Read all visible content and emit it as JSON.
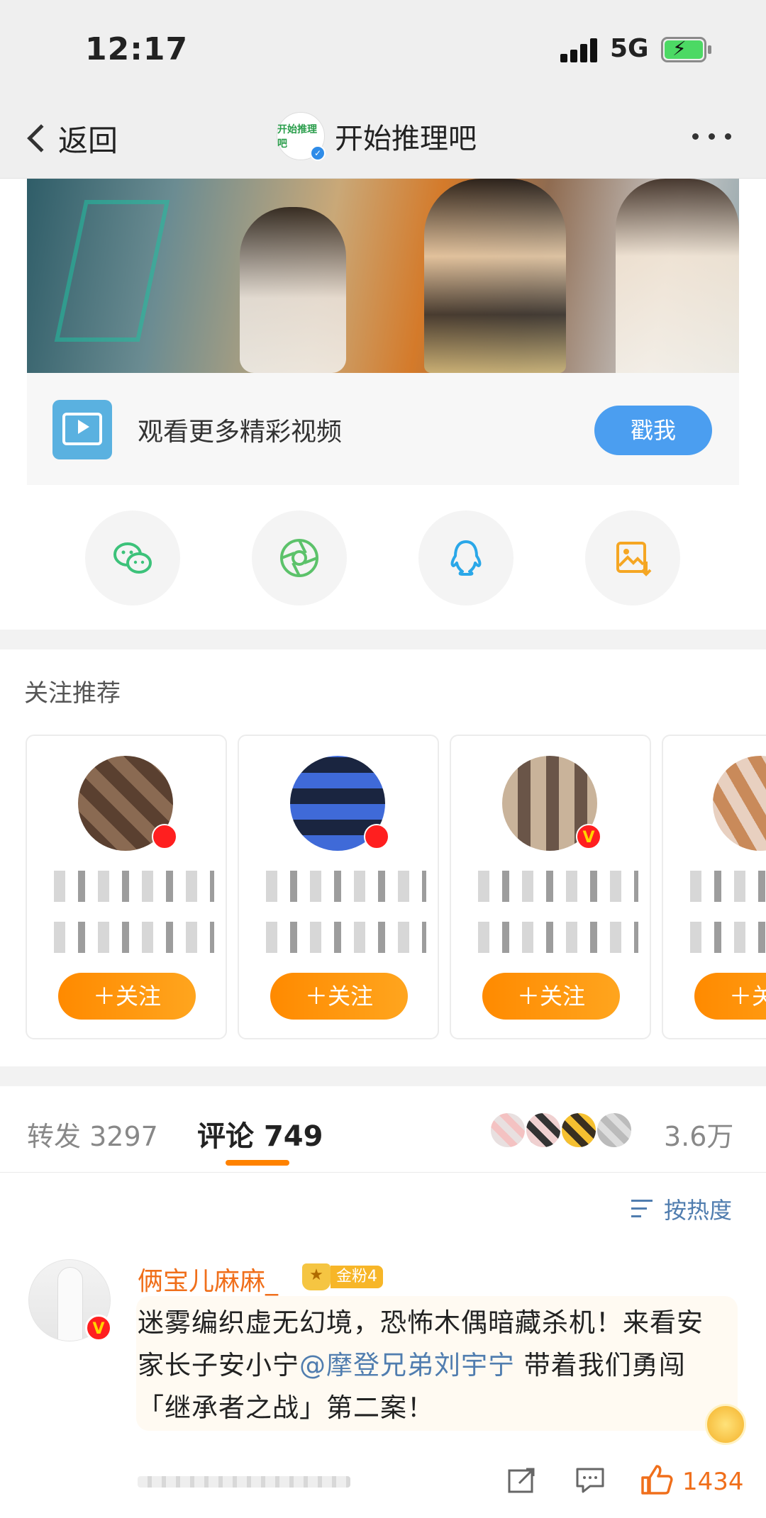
{
  "status_bar": {
    "time": "12:17",
    "network": "5G",
    "battery_charging": true
  },
  "nav": {
    "back_label": "返回",
    "title": "开始推理吧",
    "avatar_text": "开始推理吧"
  },
  "promo": {
    "video_text": "观看更多精彩视频",
    "cta_label": "戳我"
  },
  "share": {
    "icons": [
      "wechat-icon",
      "moments-icon",
      "qq-icon",
      "save-image-icon"
    ]
  },
  "recommend": {
    "title": "关注推荐",
    "follow_label": "＋关注",
    "cards": [
      {
        "name": "",
        "desc": "",
        "avatar_colors": [
          "#8a6a52",
          "#5a4030"
        ]
      },
      {
        "name": "",
        "desc": "",
        "avatar_colors": [
          "#3f6ad8",
          "#1a2540"
        ]
      },
      {
        "name": "",
        "desc": "",
        "avatar_colors": [
          "#c9b39a",
          "#6a5548"
        ]
      },
      {
        "name": "",
        "desc": "",
        "avatar_colors": [
          "#c98a5a",
          "#e8d0c0"
        ]
      }
    ]
  },
  "tabs": {
    "repost_label": "转发",
    "repost_count": "3297",
    "comment_label": "评论",
    "comment_count": "749",
    "like_count": "3.6万"
  },
  "sort": {
    "label": "按热度"
  },
  "comment": {
    "username": "俩宝儿麻麻_",
    "fan_badge": "金粉4",
    "text_before": "迷雾编织虚无幻境，恐怖木偶暗藏杀机！来看安家长子安小宁",
    "mention": "@摩登兄弟刘宇宁",
    "text_after": " 带着我们勇闯「继承者之战」第二案！",
    "likes": "1434"
  },
  "colors": {
    "accent_orange": "#ff8200",
    "link_blue": "#507daf",
    "cta_blue": "#4b9ef0"
  }
}
